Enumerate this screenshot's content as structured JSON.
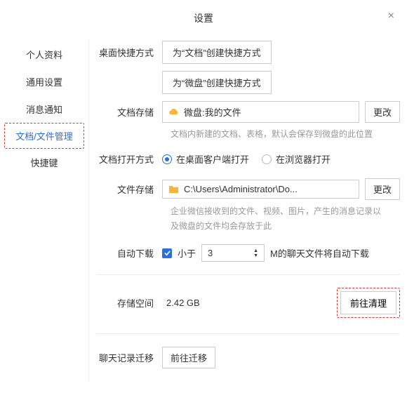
{
  "header": {
    "title": "设置",
    "close": "×"
  },
  "sidebar": {
    "items": [
      {
        "label": "个人资料"
      },
      {
        "label": "通用设置"
      },
      {
        "label": "消息通知"
      },
      {
        "label": "文档/文件管理"
      },
      {
        "label": "快捷键"
      }
    ]
  },
  "shortcut": {
    "label": "桌面快捷方式",
    "doc_btn": "为“文档”创建快捷方式",
    "drive_btn": "为“微盘”创建快捷方式"
  },
  "doc_storage": {
    "label": "文档存储",
    "path": "微盘:我的文件",
    "change_btn": "更改",
    "hint": "文档内新建的文档、表格，默认会保存到微盘的此位置"
  },
  "doc_open": {
    "label": "文档打开方式",
    "opt1": "在桌面客户端打开",
    "opt2": "在浏览器打开"
  },
  "file_storage": {
    "label": "文件存储",
    "path": "C:\\Users\\Administrator\\Do...",
    "change_btn": "更改",
    "hint": "企业微信接收到的文件、视频、图片，产生的消息记录以及微盘的文件均会存放于此"
  },
  "auto_download": {
    "label": "自动下载",
    "less_than": "小于",
    "value": "3",
    "tail": "M的聊天文件将自动下载"
  },
  "storage": {
    "label": "存储空间",
    "value": "2.42 GB",
    "cleanup_btn": "前往清理"
  },
  "history": {
    "label": "聊天记录迁移",
    "btn": "前往迁移"
  }
}
